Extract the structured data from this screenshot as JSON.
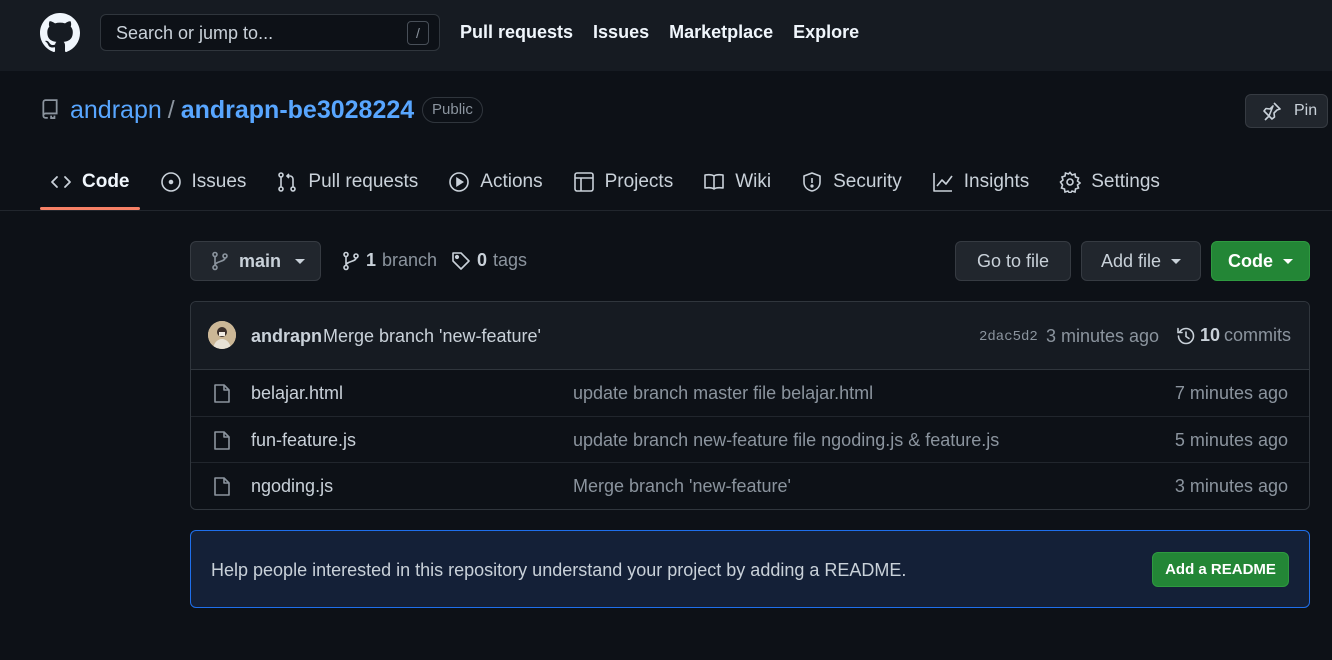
{
  "header": {
    "logo_icon": "github-mark-icon",
    "search_placeholder": "Search or jump to...",
    "search_shortcut": "/",
    "nav": [
      "Pull requests",
      "Issues",
      "Marketplace",
      "Explore"
    ]
  },
  "repo": {
    "owner": "andrapn",
    "separator": "/",
    "name": "andrapn-be3028224",
    "visibility": "Public",
    "pin_label": "Pin"
  },
  "tabs": [
    {
      "label": "Code",
      "icon": "code-icon",
      "active": true
    },
    {
      "label": "Issues",
      "icon": "issue-opened-icon"
    },
    {
      "label": "Pull requests",
      "icon": "git-pull-request-icon"
    },
    {
      "label": "Actions",
      "icon": "play-icon"
    },
    {
      "label": "Projects",
      "icon": "table-icon"
    },
    {
      "label": "Wiki",
      "icon": "book-icon"
    },
    {
      "label": "Security",
      "icon": "shield-icon"
    },
    {
      "label": "Insights",
      "icon": "graph-icon"
    },
    {
      "label": "Settings",
      "icon": "gear-icon"
    }
  ],
  "toolbar": {
    "branch": "main",
    "branch_count": "1",
    "branch_label": "branch",
    "tag_count": "0",
    "tag_label": "tags",
    "goto_file": "Go to file",
    "add_file": "Add file",
    "code": "Code"
  },
  "latest_commit": {
    "author": "andrapn",
    "message": "Merge branch 'new-feature'",
    "sha": "2dac5d2",
    "time": "3 minutes ago",
    "commit_count": "10",
    "commit_label": "commits"
  },
  "files": [
    {
      "name": "belajar.html",
      "message": "update branch master file belajar.html",
      "time": "7 minutes ago"
    },
    {
      "name": "fun-feature.js",
      "message": "update branch new-feature file ngoding.js & feature.js",
      "time": "5 minutes ago"
    },
    {
      "name": "ngoding.js",
      "message": "Merge branch 'new-feature'",
      "time": "3 minutes ago"
    }
  ],
  "readme": {
    "text": "Help people interested in this repository understand your project by adding a README.",
    "button": "Add a README"
  },
  "colors": {
    "background": "#0d1117",
    "header": "#161b22",
    "link": "#58a6ff",
    "primary_button": "#238636",
    "active_tab_underline": "#f78166"
  }
}
